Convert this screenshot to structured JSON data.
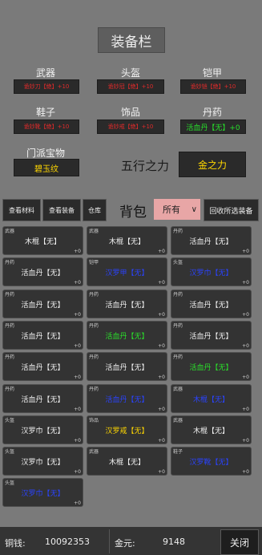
{
  "title": "装备栏",
  "slots": [
    {
      "label": "武器",
      "value": "诡妙刀【绝】+10",
      "color": "red"
    },
    {
      "label": "头盔",
      "value": "诡妙冠【绝】+10",
      "color": "red"
    },
    {
      "label": "铠甲",
      "value": "诡妙铠【绝】+10",
      "color": "red"
    },
    {
      "label": "鞋子",
      "value": "诡妙靴【绝】+10",
      "color": "red"
    },
    {
      "label": "饰品",
      "value": "诡妙戒【绝】+10",
      "color": "red"
    },
    {
      "label": "丹药",
      "value": "活血丹【无】+0",
      "color": "green"
    }
  ],
  "treasure": {
    "label": "门派宝物",
    "value": "碧玉纹"
  },
  "wuxing": {
    "label": "五行之力",
    "value": "金之力"
  },
  "toolbar": {
    "materials": "查看材料",
    "equipment": "查看装备",
    "warehouse": "仓库",
    "bag_label": "背包",
    "filter": "所有",
    "filter_arrow": "∨",
    "recycle": "回收所选装备"
  },
  "items": [
    {
      "type": "武器",
      "name": "木棍【无】",
      "count": "+0",
      "color": "white"
    },
    {
      "type": "武器",
      "name": "木棍【无】",
      "count": "+0",
      "color": "white"
    },
    {
      "type": "丹药",
      "name": "活血丹【无】",
      "count": "+0",
      "color": "white"
    },
    {
      "type": "丹药",
      "name": "活血丹【无】",
      "count": "+0",
      "color": "white"
    },
    {
      "type": "铠甲",
      "name": "汉罗甲【无】",
      "count": "+0",
      "color": "blue"
    },
    {
      "type": "头盔",
      "name": "汉罗巾【无】",
      "count": "+0",
      "color": "blue"
    },
    {
      "type": "丹药",
      "name": "活血丹【无】",
      "count": "+0",
      "color": "white"
    },
    {
      "type": "丹药",
      "name": "活血丹【无】",
      "count": "+0",
      "color": "white"
    },
    {
      "type": "丹药",
      "name": "活血丹【无】",
      "count": "+0",
      "color": "white"
    },
    {
      "type": "丹药",
      "name": "活血丹【无】",
      "count": "+0",
      "color": "white"
    },
    {
      "type": "丹药",
      "name": "活血丹【无】",
      "count": "+0",
      "color": "green"
    },
    {
      "type": "丹药",
      "name": "活血丹【无】",
      "count": "+0",
      "color": "white"
    },
    {
      "type": "丹药",
      "name": "活血丹【无】",
      "count": "+0",
      "color": "white"
    },
    {
      "type": "丹药",
      "name": "活血丹【无】",
      "count": "+0",
      "color": "white"
    },
    {
      "type": "丹药",
      "name": "活血丹【无】",
      "count": "+0",
      "color": "green"
    },
    {
      "type": "丹药",
      "name": "活血丹【无】",
      "count": "+0",
      "color": "white"
    },
    {
      "type": "丹药",
      "name": "活血丹【无】",
      "count": "+0",
      "color": "blue"
    },
    {
      "type": "武器",
      "name": "木棍【无】",
      "count": "+0",
      "color": "blue"
    },
    {
      "type": "头盔",
      "name": "汉罗巾【无】",
      "count": "+0",
      "color": "white"
    },
    {
      "type": "饰品",
      "name": "汉罗戒【无】",
      "count": "+0",
      "color": "yellow"
    },
    {
      "type": "武器",
      "name": "木棍【无】",
      "count": "+0",
      "color": "white"
    },
    {
      "type": "头盔",
      "name": "汉罗巾【无】",
      "count": "+0",
      "color": "white"
    },
    {
      "type": "武器",
      "name": "木棍【无】",
      "count": "+0",
      "color": "white"
    },
    {
      "type": "鞋子",
      "name": "汉罗靴【无】",
      "count": "+0",
      "color": "blue"
    },
    {
      "type": "头盔",
      "name": "汉罗巾【无】",
      "count": "+0",
      "color": "blue"
    }
  ],
  "footer": {
    "copper_label": "铜钱:",
    "copper_value": "10092353",
    "gold_label": "金元:",
    "gold_value": "9148",
    "close": "关闭"
  }
}
